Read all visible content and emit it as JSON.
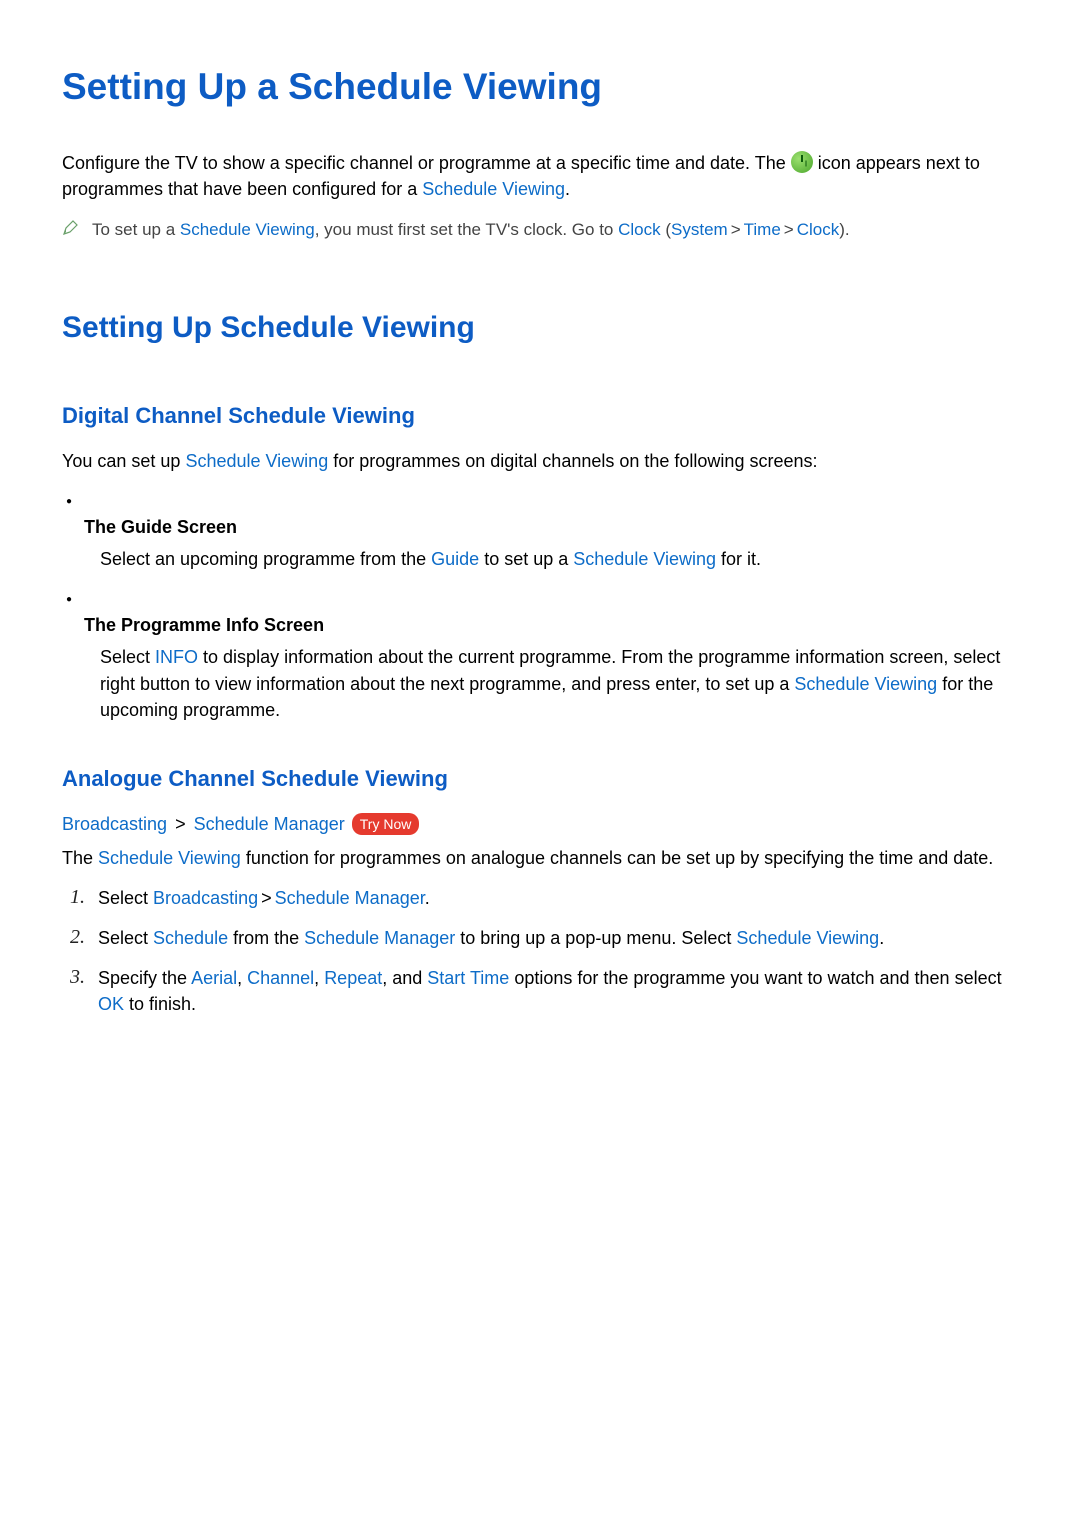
{
  "title": "Setting Up a Schedule Viewing",
  "intro": {
    "pre": "Configure the TV to show a specific channel or programme at a specific time and date. The ",
    "post": " icon appears next to programmes that have been configured for a ",
    "schedule_viewing": "Schedule Viewing",
    "period": "."
  },
  "note": {
    "pre": "To set up a ",
    "schedule_viewing": "Schedule Viewing",
    "mid": ", you must first set the TV's clock. Go to ",
    "clock1": "Clock",
    "open": " (",
    "system": "System",
    "time": "Time",
    "clock2": "Clock",
    "close": ")."
  },
  "section_title": "Setting Up Schedule Viewing",
  "digital": {
    "heading": "Digital Channel Schedule Viewing",
    "para_pre": "You can set up ",
    "schedule_viewing": "Schedule Viewing",
    "para_post": " for programmes on digital channels on the following screens:",
    "b1_title": "The Guide Screen",
    "b1_pre": "Select an upcoming programme from the ",
    "b1_guide": "Guide",
    "b1_mid": " to set up a ",
    "b1_sv": "Schedule Viewing",
    "b1_post": " for it.",
    "b2_title": "The Programme Info Screen",
    "b2_pre": "Select ",
    "b2_info": "INFO",
    "b2_mid": " to display information about the current programme. From the programme information screen, select right button to view information about the next programme, and press enter, to set up a ",
    "b2_sv": "Schedule Viewing",
    "b2_post": " for the upcoming programme."
  },
  "analogue": {
    "heading": "Analogue Channel Schedule Viewing",
    "bc_broadcasting": "Broadcasting",
    "bc_schedule_manager": "Schedule Manager",
    "try_now": "Try Now",
    "para_pre": "The ",
    "para_sv": "Schedule Viewing",
    "para_post": " function for programmes on analogue channels can be set up by specifying the time and date.",
    "s1_pre": "Select ",
    "s1_broadcasting": "Broadcasting",
    "s1_sm": "Schedule Manager",
    "s1_post": ".",
    "s2_pre": "Select ",
    "s2_schedule": "Schedule",
    "s2_mid1": " from the ",
    "s2_sm": "Schedule Manager",
    "s2_mid2": " to bring up a pop-up menu. Select ",
    "s2_sv": "Schedule Viewing",
    "s2_post": ".",
    "s3_pre": "Specify the ",
    "s3_aerial": "Aerial",
    "s3_channel": "Channel",
    "s3_repeat": "Repeat",
    "s3_and": ", and ",
    "s3_start": "Start Time",
    "s3_mid": " options for the programme you want to watch and then select ",
    "s3_ok": "OK",
    "s3_post": " to finish."
  },
  "sep_comma": ", ",
  "sep_gt": ">"
}
